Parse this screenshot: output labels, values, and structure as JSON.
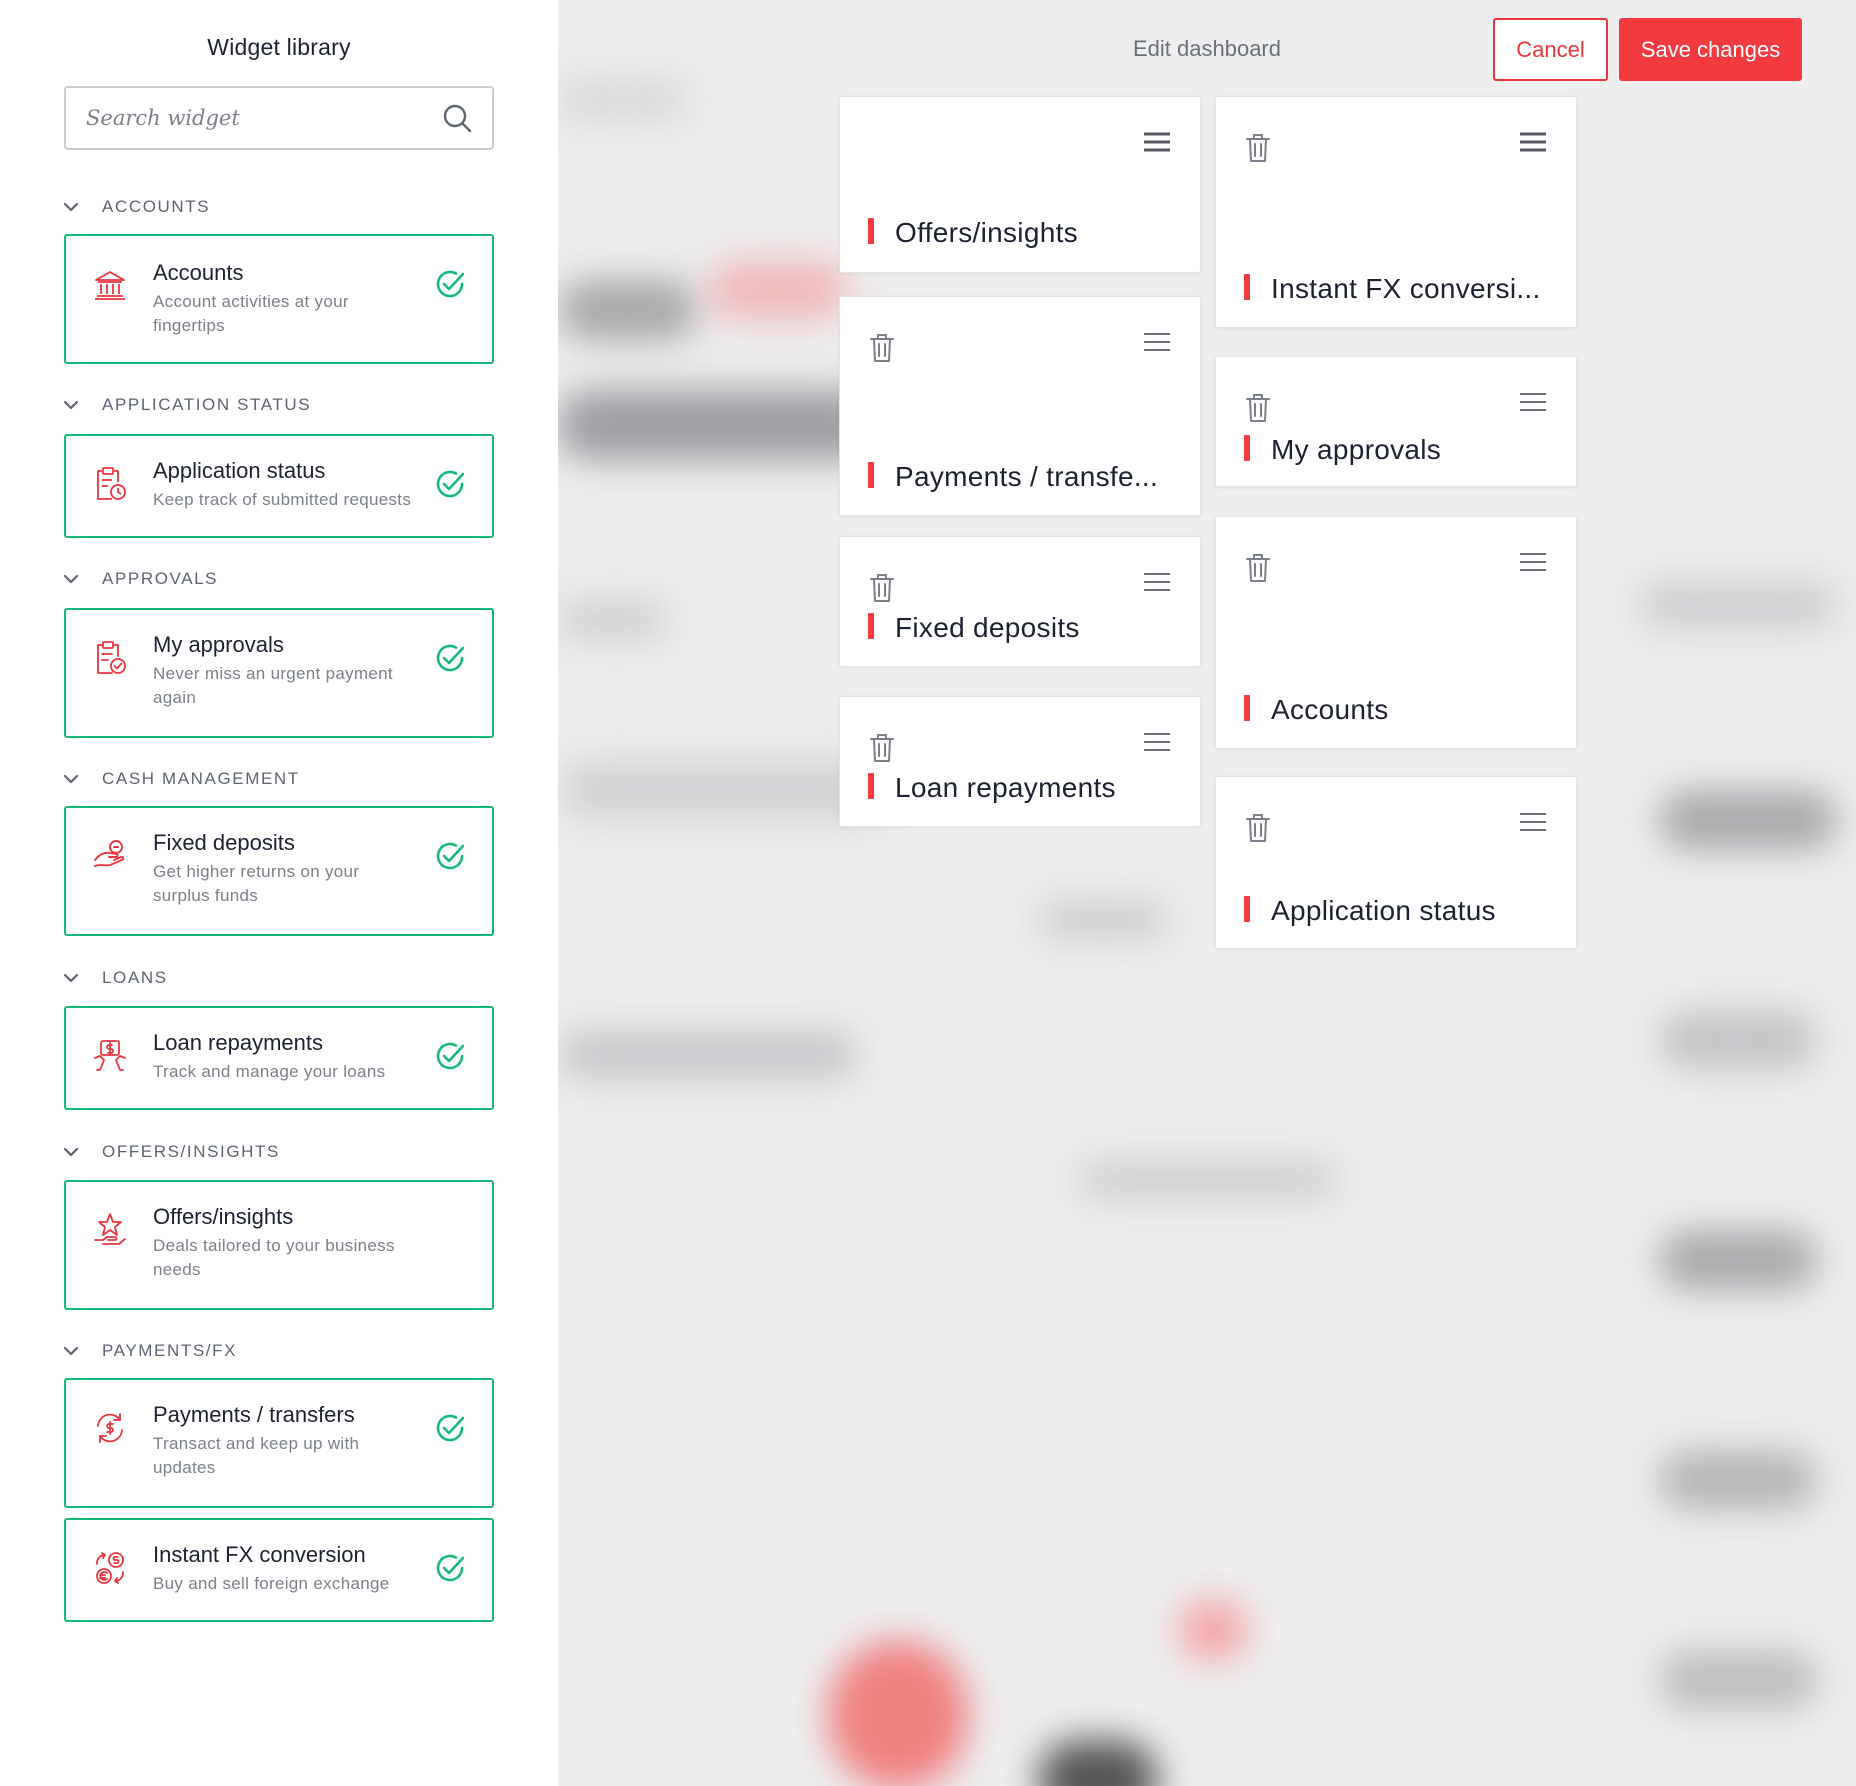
{
  "sidebar": {
    "title": "Widget library",
    "search": {
      "placeholder": "Search widget",
      "value": ""
    },
    "sections": [
      {
        "header": "ACCOUNTS",
        "widgets": [
          {
            "title": "Accounts",
            "desc": "Account activities at your fingertips",
            "icon": "bank-icon",
            "added": true
          }
        ]
      },
      {
        "header": "APPLICATION STATUS",
        "widgets": [
          {
            "title": "Application status",
            "desc": "Keep track of submitted requests",
            "icon": "clipboard-clock-icon",
            "added": true
          }
        ]
      },
      {
        "header": "APPROVALS",
        "widgets": [
          {
            "title": "My approvals",
            "desc": "Never miss an urgent payment again",
            "icon": "clipboard-check-icon",
            "added": true
          }
        ]
      },
      {
        "header": "CASH MANAGEMENT",
        "widgets": [
          {
            "title": "Fixed deposits",
            "desc": "Get higher returns on your surplus funds",
            "icon": "hand-coin-icon",
            "added": true
          }
        ]
      },
      {
        "header": "LOANS",
        "widgets": [
          {
            "title": "Loan repayments",
            "desc": "Track and manage your loans",
            "icon": "money-hand-icon",
            "added": true
          }
        ]
      },
      {
        "header": "OFFERS/INSIGHTS",
        "widgets": [
          {
            "title": "Offers/insights",
            "desc": "Deals tailored to your business needs",
            "icon": "star-hand-icon",
            "added": false
          }
        ]
      },
      {
        "header": "PAYMENTS/FX",
        "widgets": [
          {
            "title": "Payments / transfers",
            "desc": "Transact and keep up with updates",
            "icon": "dollar-transfer-icon",
            "added": true
          },
          {
            "title": "Instant FX conversion",
            "desc": "Buy and sell foreign exchange",
            "icon": "currency-exchange-icon",
            "added": true
          }
        ]
      }
    ]
  },
  "header": {
    "title": "Edit dashboard",
    "cancel_label": "Cancel",
    "save_label": "Save changes"
  },
  "dashboard": {
    "left_column": [
      {
        "title": "Offers/insights",
        "deletable": false
      },
      {
        "title": "Payments / transfe...",
        "deletable": true
      },
      {
        "title": "Fixed deposits",
        "deletable": true
      },
      {
        "title": "Loan repayments",
        "deletable": true
      }
    ],
    "right_column": [
      {
        "title": "Instant FX conversi...",
        "deletable": true
      },
      {
        "title": "My approvals",
        "deletable": true
      },
      {
        "title": "Accounts",
        "deletable": true
      },
      {
        "title": "Application status",
        "deletable": true
      }
    ]
  },
  "colors": {
    "accent_red": "#f23a3f",
    "check_green": "#17b979",
    "icon_red": "#e8363c"
  }
}
